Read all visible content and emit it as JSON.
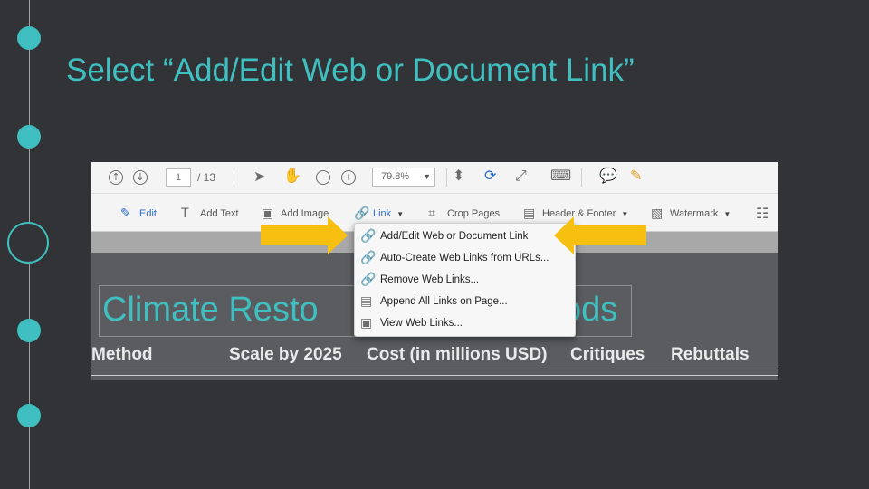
{
  "slide": {
    "title": "Select “Add/Edit Web or Document Link”",
    "accent_color": "#3fbfbf",
    "background_color": "#323337",
    "timeline_markers": [
      "dot",
      "dot",
      "ring",
      "dot",
      "dot"
    ]
  },
  "screenshot": {
    "toolbar": {
      "up_icon": "arrow-up-circle-icon",
      "down_icon": "arrow-down-circle-icon",
      "page_current": "1",
      "page_total": "/ 13",
      "pointer_icon": "pointer-icon",
      "hand_icon": "hand-icon",
      "zoom_out_icon": "zoom-out-icon",
      "zoom_in_icon": "zoom-in-icon",
      "zoom_level": "79.8%",
      "fit_icon": "fit-page-icon",
      "rotate_icon": "rotate-icon",
      "fullscreen_icon": "fullscreen-icon",
      "keyboard_icon": "keyboard-icon",
      "comment_icon": "comment-icon",
      "highlight_icon": "highlight-pen-icon"
    },
    "edit_tools": {
      "edit": "Edit",
      "add_text": "Add Text",
      "add_image": "Add Image",
      "link": "Link",
      "crop_pages": "Crop Pages",
      "header_footer": "Header & Footer",
      "watermark": "Watermark"
    },
    "link_menu": {
      "items": [
        {
          "label": "Add/Edit Web or Document Link",
          "icon": "link-edit-icon"
        },
        {
          "label": "Auto-Create Web Links from URLs...",
          "icon": "link-auto-icon"
        },
        {
          "label": "Remove Web Links...",
          "icon": "link-remove-icon"
        },
        {
          "label": "Append All Links on Page...",
          "icon": "link-append-icon"
        },
        {
          "label": "View Web Links...",
          "icon": "link-view-icon"
        }
      ],
      "highlight_color": "#f7bf10"
    },
    "document": {
      "title_start": "Climate Resto",
      "title_end": "ods",
      "columns": [
        "Method",
        "Scale by 2025",
        "Cost (in millions USD)",
        "Critiques",
        "Rebuttals"
      ]
    }
  }
}
